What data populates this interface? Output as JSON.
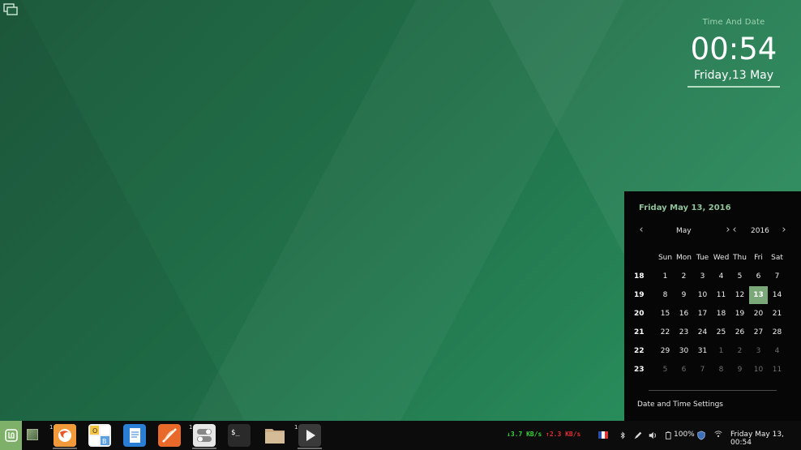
{
  "desklet": {
    "title": "Time And Date",
    "time": "00:54",
    "date": "Friday,13 May"
  },
  "calendar": {
    "header": "Friday May 13, 2016",
    "month": "May",
    "year": "2016",
    "weekdays": [
      "Sun",
      "Mon",
      "Tue",
      "Wed",
      "Thu",
      "Fri",
      "Sat"
    ],
    "weeks": [
      {
        "num": "18",
        "days": [
          {
            "d": "1"
          },
          {
            "d": "2"
          },
          {
            "d": "3"
          },
          {
            "d": "4"
          },
          {
            "d": "5"
          },
          {
            "d": "6"
          },
          {
            "d": "7"
          }
        ]
      },
      {
        "num": "19",
        "days": [
          {
            "d": "8"
          },
          {
            "d": "9"
          },
          {
            "d": "10"
          },
          {
            "d": "11"
          },
          {
            "d": "12"
          },
          {
            "d": "13",
            "today": true
          },
          {
            "d": "14"
          }
        ]
      },
      {
        "num": "20",
        "days": [
          {
            "d": "15"
          },
          {
            "d": "16"
          },
          {
            "d": "17"
          },
          {
            "d": "18"
          },
          {
            "d": "19"
          },
          {
            "d": "20"
          },
          {
            "d": "21"
          }
        ]
      },
      {
        "num": "21",
        "days": [
          {
            "d": "22"
          },
          {
            "d": "23"
          },
          {
            "d": "24"
          },
          {
            "d": "25"
          },
          {
            "d": "26"
          },
          {
            "d": "27"
          },
          {
            "d": "28"
          }
        ]
      },
      {
        "num": "22",
        "days": [
          {
            "d": "29"
          },
          {
            "d": "30"
          },
          {
            "d": "31"
          },
          {
            "d": "1",
            "other": true
          },
          {
            "d": "2",
            "other": true
          },
          {
            "d": "3",
            "other": true
          },
          {
            "d": "4",
            "other": true
          }
        ]
      },
      {
        "num": "23",
        "days": [
          {
            "d": "5",
            "other": true
          },
          {
            "d": "6",
            "other": true
          },
          {
            "d": "7",
            "other": true
          },
          {
            "d": "8",
            "other": true
          },
          {
            "d": "9",
            "other": true
          },
          {
            "d": "10",
            "other": true
          },
          {
            "d": "11",
            "other": true
          }
        ]
      }
    ],
    "settings_label": "Date and Time Settings",
    "today_color": "#7aa878"
  },
  "taskbar": {
    "launchers": [
      {
        "name": "firefox",
        "icon": "firefox-icon",
        "count": "1"
      },
      {
        "name": "office",
        "icon": "office-icon",
        "count": ""
      },
      {
        "name": "text-editor",
        "icon": "text-editor-icon",
        "count": ""
      },
      {
        "name": "gmusicbrowser",
        "icon": "music-player-icon",
        "count": ""
      },
      {
        "name": "settings",
        "icon": "settings-toggle-icon",
        "count": "1"
      },
      {
        "name": "terminal",
        "icon": "terminal-icon",
        "count": ""
      },
      {
        "name": "files",
        "icon": "folder-icon",
        "count": ""
      },
      {
        "name": "media-player",
        "icon": "media-player-icon",
        "count": "1"
      }
    ],
    "net_down": "↓3.7 KB/s",
    "net_up": "↑2.3 KB/s",
    "battery": "100%",
    "clock": "Friday May 13, 00:54",
    "menu_color": "#7fb069"
  }
}
